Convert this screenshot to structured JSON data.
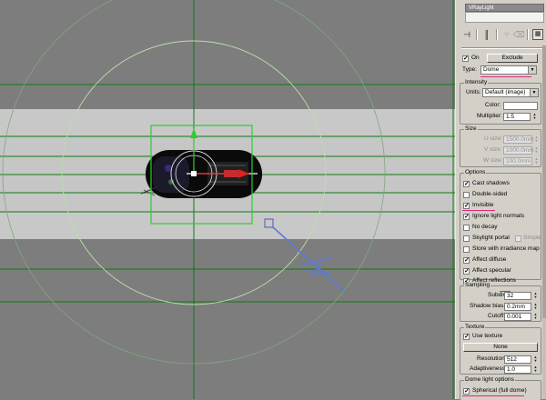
{
  "object_name": "VRayLight",
  "toolbar": [
    "pin-stack-icon",
    "show-end-result-icon",
    "make-unique-icon",
    "remove-modifier-icon",
    "configure-sets-icon"
  ],
  "general": {
    "on_label": "On",
    "on_checked": true,
    "exclude_label": "Exclude",
    "type_label": "Type:",
    "type_value": "Dome"
  },
  "intensity": {
    "title": "Intensity",
    "units_label": "Units:",
    "units_value": "Default (image)",
    "color_label": "Color:",
    "color_value": "#ffffff",
    "multiplier_label": "Multiplier:",
    "multiplier_value": "1.5"
  },
  "size": {
    "title": "Size",
    "u_label": "U size:",
    "u_value": "1500.0mm",
    "v_label": "V size:",
    "v_value": "1000.0mm",
    "w_label": "W size:",
    "w_value": "100.0mm"
  },
  "options": {
    "title": "Options",
    "cast_shadows": {
      "label": "Cast shadows",
      "checked": true
    },
    "double_sided": {
      "label": "Double-sided",
      "checked": false
    },
    "invisible": {
      "label": "Invisible",
      "checked": true
    },
    "ignore_light_normals": {
      "label": "Ignore light normals",
      "checked": true
    },
    "no_decay": {
      "label": "No decay",
      "checked": false
    },
    "skylight_portal": {
      "label": "Skylight portal",
      "checked": false
    },
    "simple": {
      "label": "Simple",
      "checked": false
    },
    "store_irradiance": {
      "label": "Store with irradiance map",
      "checked": false
    },
    "affect_diffuse": {
      "label": "Affect diffuse",
      "checked": true
    },
    "affect_specular": {
      "label": "Affect specular",
      "checked": true
    },
    "affect_reflections": {
      "label": "Affect reflections",
      "checked": true
    }
  },
  "sampling": {
    "title": "Sampling",
    "subdivs_label": "Subdivs:",
    "subdivs_value": "32",
    "shadow_bias_label": "Shadow bias:",
    "shadow_bias_value": "0.2mm",
    "cutoff_label": "Cutoff:",
    "cutoff_value": "0.001"
  },
  "texture": {
    "title": "Texture",
    "use_texture": {
      "label": "Use texture",
      "checked": true
    },
    "none_label": "None",
    "resolution_label": "Resolution:",
    "resolution_value": "512",
    "adaptiveness_label": "Adaptiveness:",
    "adaptiveness_value": "1.0"
  },
  "dome": {
    "title": "Dome light options",
    "spherical": {
      "label": "Spherical (full dome)",
      "checked": true
    }
  },
  "colors": {
    "highlight_underline": "#e0287d",
    "gizmo_green": "#2ecc2e",
    "grid_dark_green": "#0f6e0f",
    "dome_circle": "#9fc59f"
  }
}
